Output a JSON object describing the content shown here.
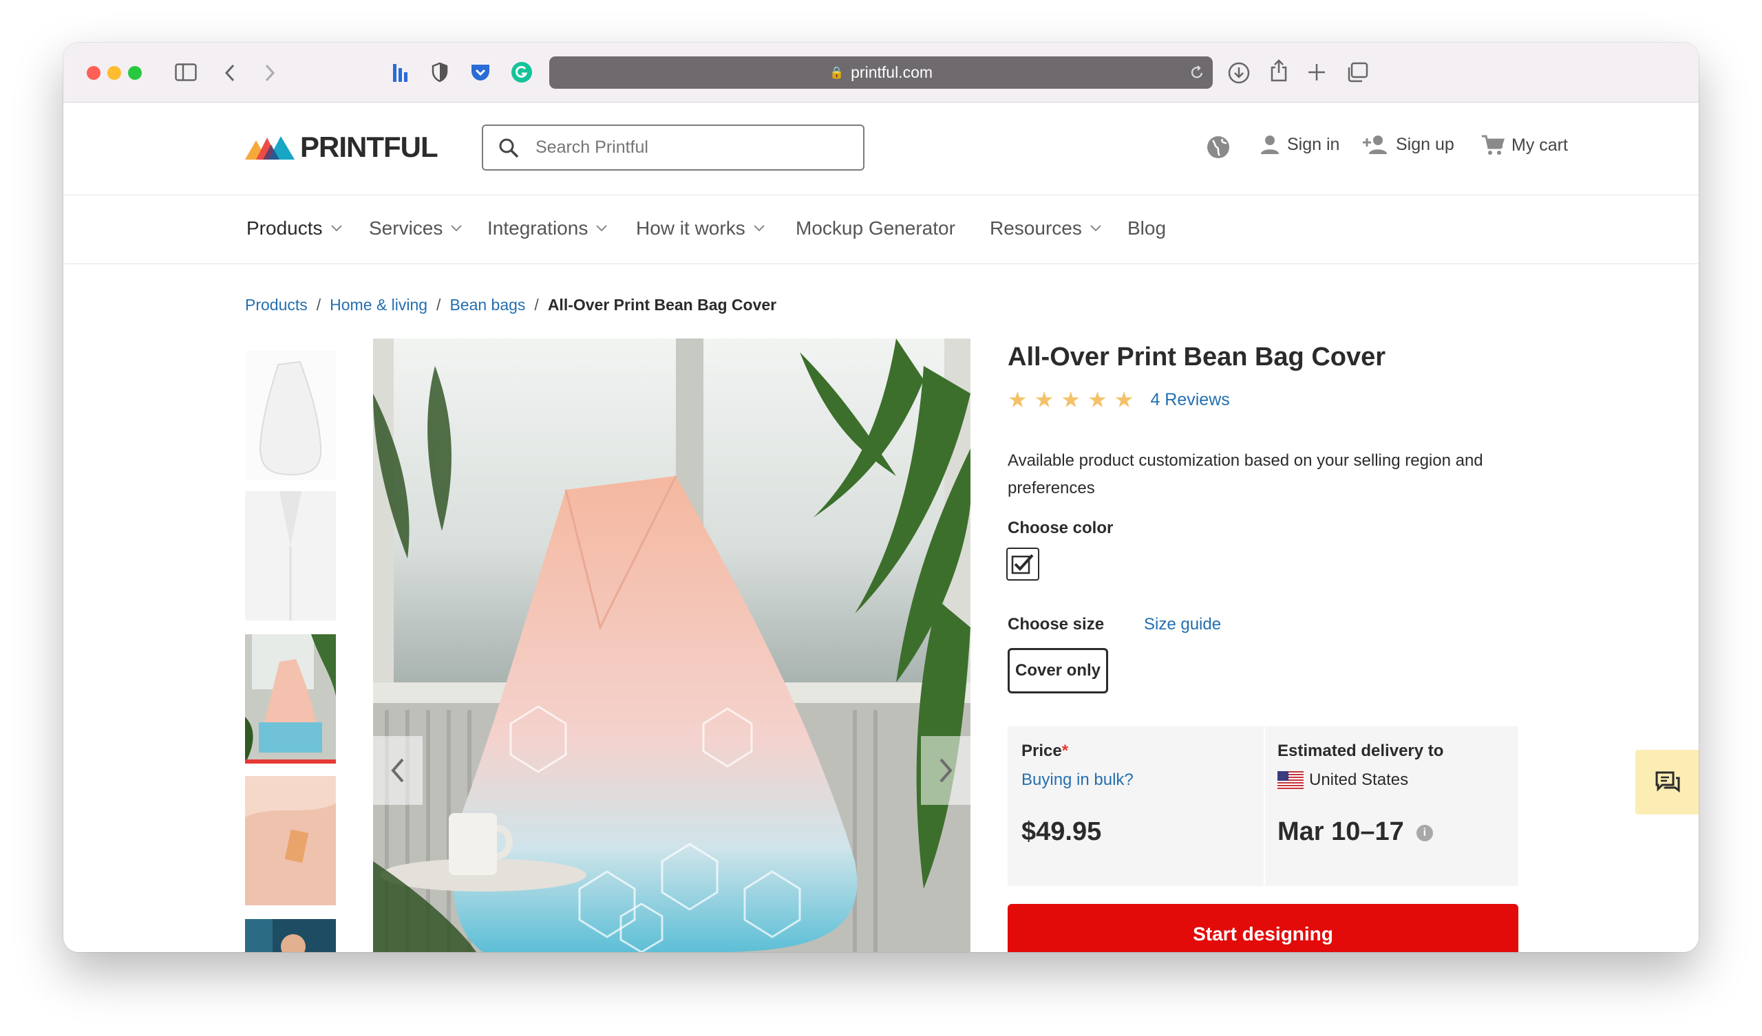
{
  "browser": {
    "url": "printful.com",
    "traffic_colors": [
      "#ff5f57",
      "#febc2e",
      "#28c840"
    ]
  },
  "header": {
    "logo_text": "PRINTFUL",
    "search_placeholder": "Search Printful",
    "sign_in": "Sign in",
    "sign_up": "Sign up",
    "cart": "My cart"
  },
  "nav": {
    "items": [
      "Products",
      "Services",
      "Integrations",
      "How it works",
      "Mockup Generator",
      "Resources",
      "Blog"
    ]
  },
  "breadcrumb": {
    "items": [
      "Products",
      "Home & living",
      "Bean bags"
    ],
    "current": "All-Over Print Bean Bag Cover"
  },
  "product": {
    "title": "All-Over Print Bean Bag Cover",
    "rating": 5,
    "reviews": "4 Reviews",
    "description": "Available product customization based on your selling region and preferences",
    "choose_color": "Choose color",
    "choose_size": "Choose size",
    "size_guide": "Size guide",
    "size_option": "Cover only",
    "price_label": "Price",
    "price_required": "*",
    "bulk_link": "Buying in bulk?",
    "price": "$49.95",
    "delivery_label": "Estimated delivery to",
    "delivery_country": "United States",
    "delivery_dates": "Mar 10–17",
    "info_glyph": "i",
    "cta": "Start designing"
  },
  "colors": {
    "link": "#246fb0",
    "cta": "#e30a0a",
    "star": "#f4c26a",
    "chat_bg": "#fbedb4"
  },
  "gallery": {
    "selected_thumbnail": 3,
    "thumbnail_count": 5
  }
}
